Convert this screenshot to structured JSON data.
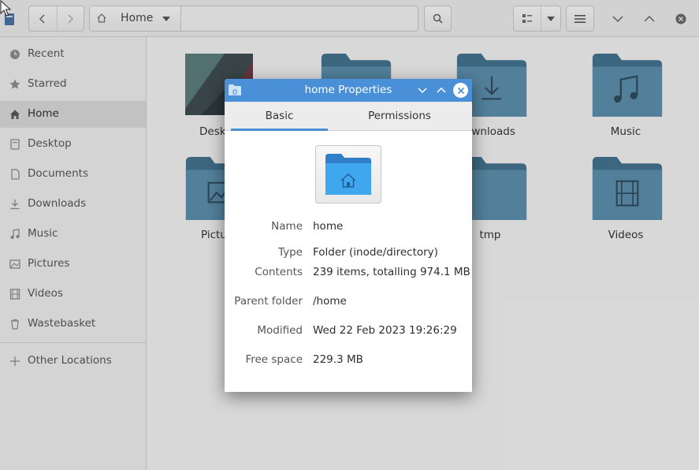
{
  "header": {
    "path_segment": "Home",
    "icons": [
      "back-icon",
      "forward-icon",
      "home-icon",
      "search-icon",
      "list-view-icon",
      "menu-icon",
      "minimize-icon",
      "maximize-icon",
      "close-icon"
    ]
  },
  "sidebar": {
    "items": [
      {
        "label": "Recent",
        "icon": "clock-icon"
      },
      {
        "label": "Starred",
        "icon": "star-icon"
      },
      {
        "label": "Home",
        "icon": "home-icon",
        "active": true
      },
      {
        "label": "Desktop",
        "icon": "desktop-icon"
      },
      {
        "label": "Documents",
        "icon": "document-icon"
      },
      {
        "label": "Downloads",
        "icon": "download-icon"
      },
      {
        "label": "Music",
        "icon": "music-icon"
      },
      {
        "label": "Pictures",
        "icon": "picture-icon"
      },
      {
        "label": "Videos",
        "icon": "video-icon"
      },
      {
        "label": "Wastebasket",
        "icon": "trash-icon"
      }
    ],
    "other_locations": "Other Locations"
  },
  "folders": {
    "desktop": "Desk",
    "downloads": "ownloads",
    "music": "Music",
    "pictures": "Pictu",
    "tmp": "tmp",
    "videos": "Videos"
  },
  "dialog": {
    "title": "home Properties",
    "tabs": [
      "Basic",
      "Permissions"
    ],
    "active_tab": "Basic",
    "properties": {
      "name_label": "Name",
      "name_value": "home",
      "type_label": "Type",
      "type_value": "Folder (inode/directory)",
      "contents_label": "Contents",
      "contents_value": "239 items, totalling 974.1 MB",
      "parent_label": "Parent folder",
      "parent_value": "/home",
      "modified_label": "Modified",
      "modified_value": "Wed 22 Feb 2023 19:26:29",
      "free_label": "Free space",
      "free_value": "229.3 MB"
    }
  },
  "colors": {
    "accent": "#4a90d9",
    "folder": "#5a8aa8",
    "folder_dark": "#436f8c"
  }
}
